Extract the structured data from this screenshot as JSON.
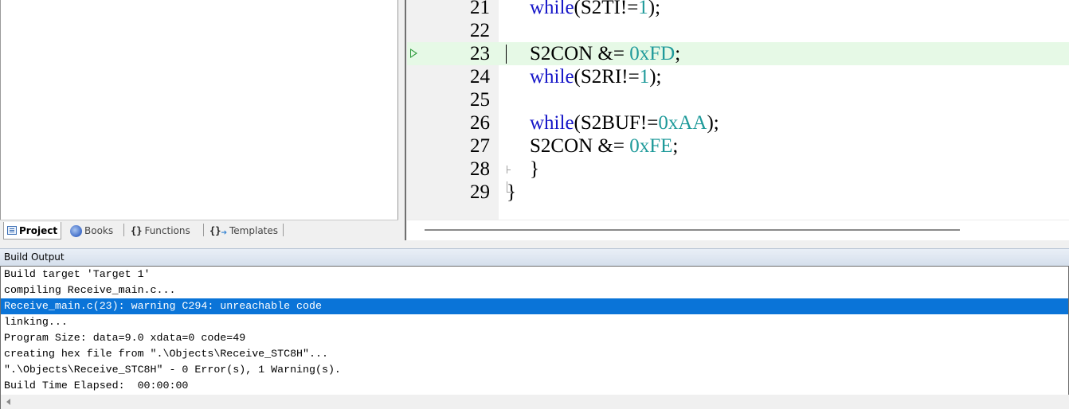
{
  "project_tabs": [
    {
      "label": "Project",
      "icon": "project-icon",
      "active": true
    },
    {
      "label": "Books",
      "icon": "books-icon",
      "active": false
    },
    {
      "label": "Functions",
      "icon": "functions-icon",
      "glyph": "{}",
      "active": false
    },
    {
      "label": "Templates",
      "icon": "templates-icon",
      "glyph": "{}",
      "active": false
    }
  ],
  "editor": {
    "lines": [
      {
        "num": "21",
        "tokens": [
          [
            "kw",
            "while"
          ],
          [
            "plain",
            "(S2TI!="
          ],
          [
            "num",
            "1"
          ],
          [
            "plain",
            ");"
          ]
        ]
      },
      {
        "num": "22",
        "tokens": []
      },
      {
        "num": "23",
        "tokens": [
          [
            "plain",
            "S2CON &= "
          ],
          [
            "num",
            "0xFD"
          ],
          [
            "plain",
            ";"
          ]
        ],
        "current": true
      },
      {
        "num": "24",
        "tokens": [
          [
            "kw",
            "while"
          ],
          [
            "plain",
            "(S2RI!="
          ],
          [
            "num",
            "1"
          ],
          [
            "plain",
            ");"
          ]
        ]
      },
      {
        "num": "25",
        "tokens": []
      },
      {
        "num": "26",
        "tokens": [
          [
            "kw",
            "while"
          ],
          [
            "plain",
            "(S2BUF!="
          ],
          [
            "num",
            "0xAA"
          ],
          [
            "plain",
            ");"
          ]
        ]
      },
      {
        "num": "27",
        "tokens": [
          [
            "plain",
            "S2CON &= "
          ],
          [
            "num",
            "0xFE"
          ],
          [
            "plain",
            ";"
          ]
        ]
      },
      {
        "num": "28",
        "tokens": [
          [
            "plain",
            "}"
          ]
        ]
      },
      {
        "num": "29",
        "tokens": [
          [
            "plain",
            "}"
          ]
        ],
        "outdent": true
      }
    ],
    "colors": {
      "keyword": "#1616c8",
      "number": "#1e9a9a",
      "current_line": "#e6f9e6"
    }
  },
  "build_output": {
    "title": "Build Output",
    "lines": [
      "Build target 'Target 1'",
      "compiling Receive_main.c...",
      "Receive_main.c(23): warning C294: unreachable code",
      "linking...",
      "Program Size: data=9.0 xdata=0 code=49",
      "creating hex file from \".\\Objects\\Receive_STC8H\"...",
      "\".\\Objects\\Receive_STC8H\" - 0 Error(s), 1 Warning(s).",
      "Build Time Elapsed:  00:00:00"
    ],
    "selected_index": 2,
    "selection_color": "#0a74d8"
  }
}
